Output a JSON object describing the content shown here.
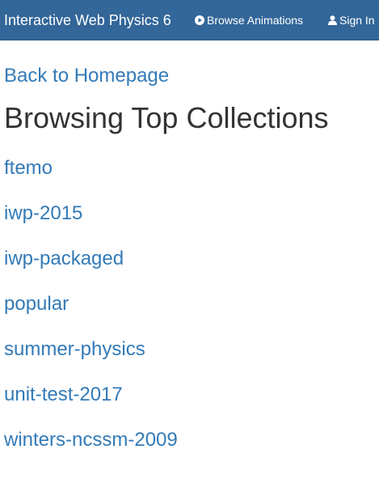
{
  "navbar": {
    "brand": "Interactive Web Physics 6",
    "browse_label": "Browse Animations",
    "browse_icon": "play-circle-icon",
    "signin_label": "Sign In",
    "signin_icon": "user-icon",
    "background_color": "#336699"
  },
  "main": {
    "back_link": "Back to Homepage",
    "title": "Browsing Top Collections",
    "link_color": "#337ab7",
    "collections": [
      "ftemo",
      "iwp-2015",
      "iwp-packaged",
      "popular",
      "summer-physics",
      "unit-test-2017",
      "winters-ncssm-2009"
    ]
  }
}
